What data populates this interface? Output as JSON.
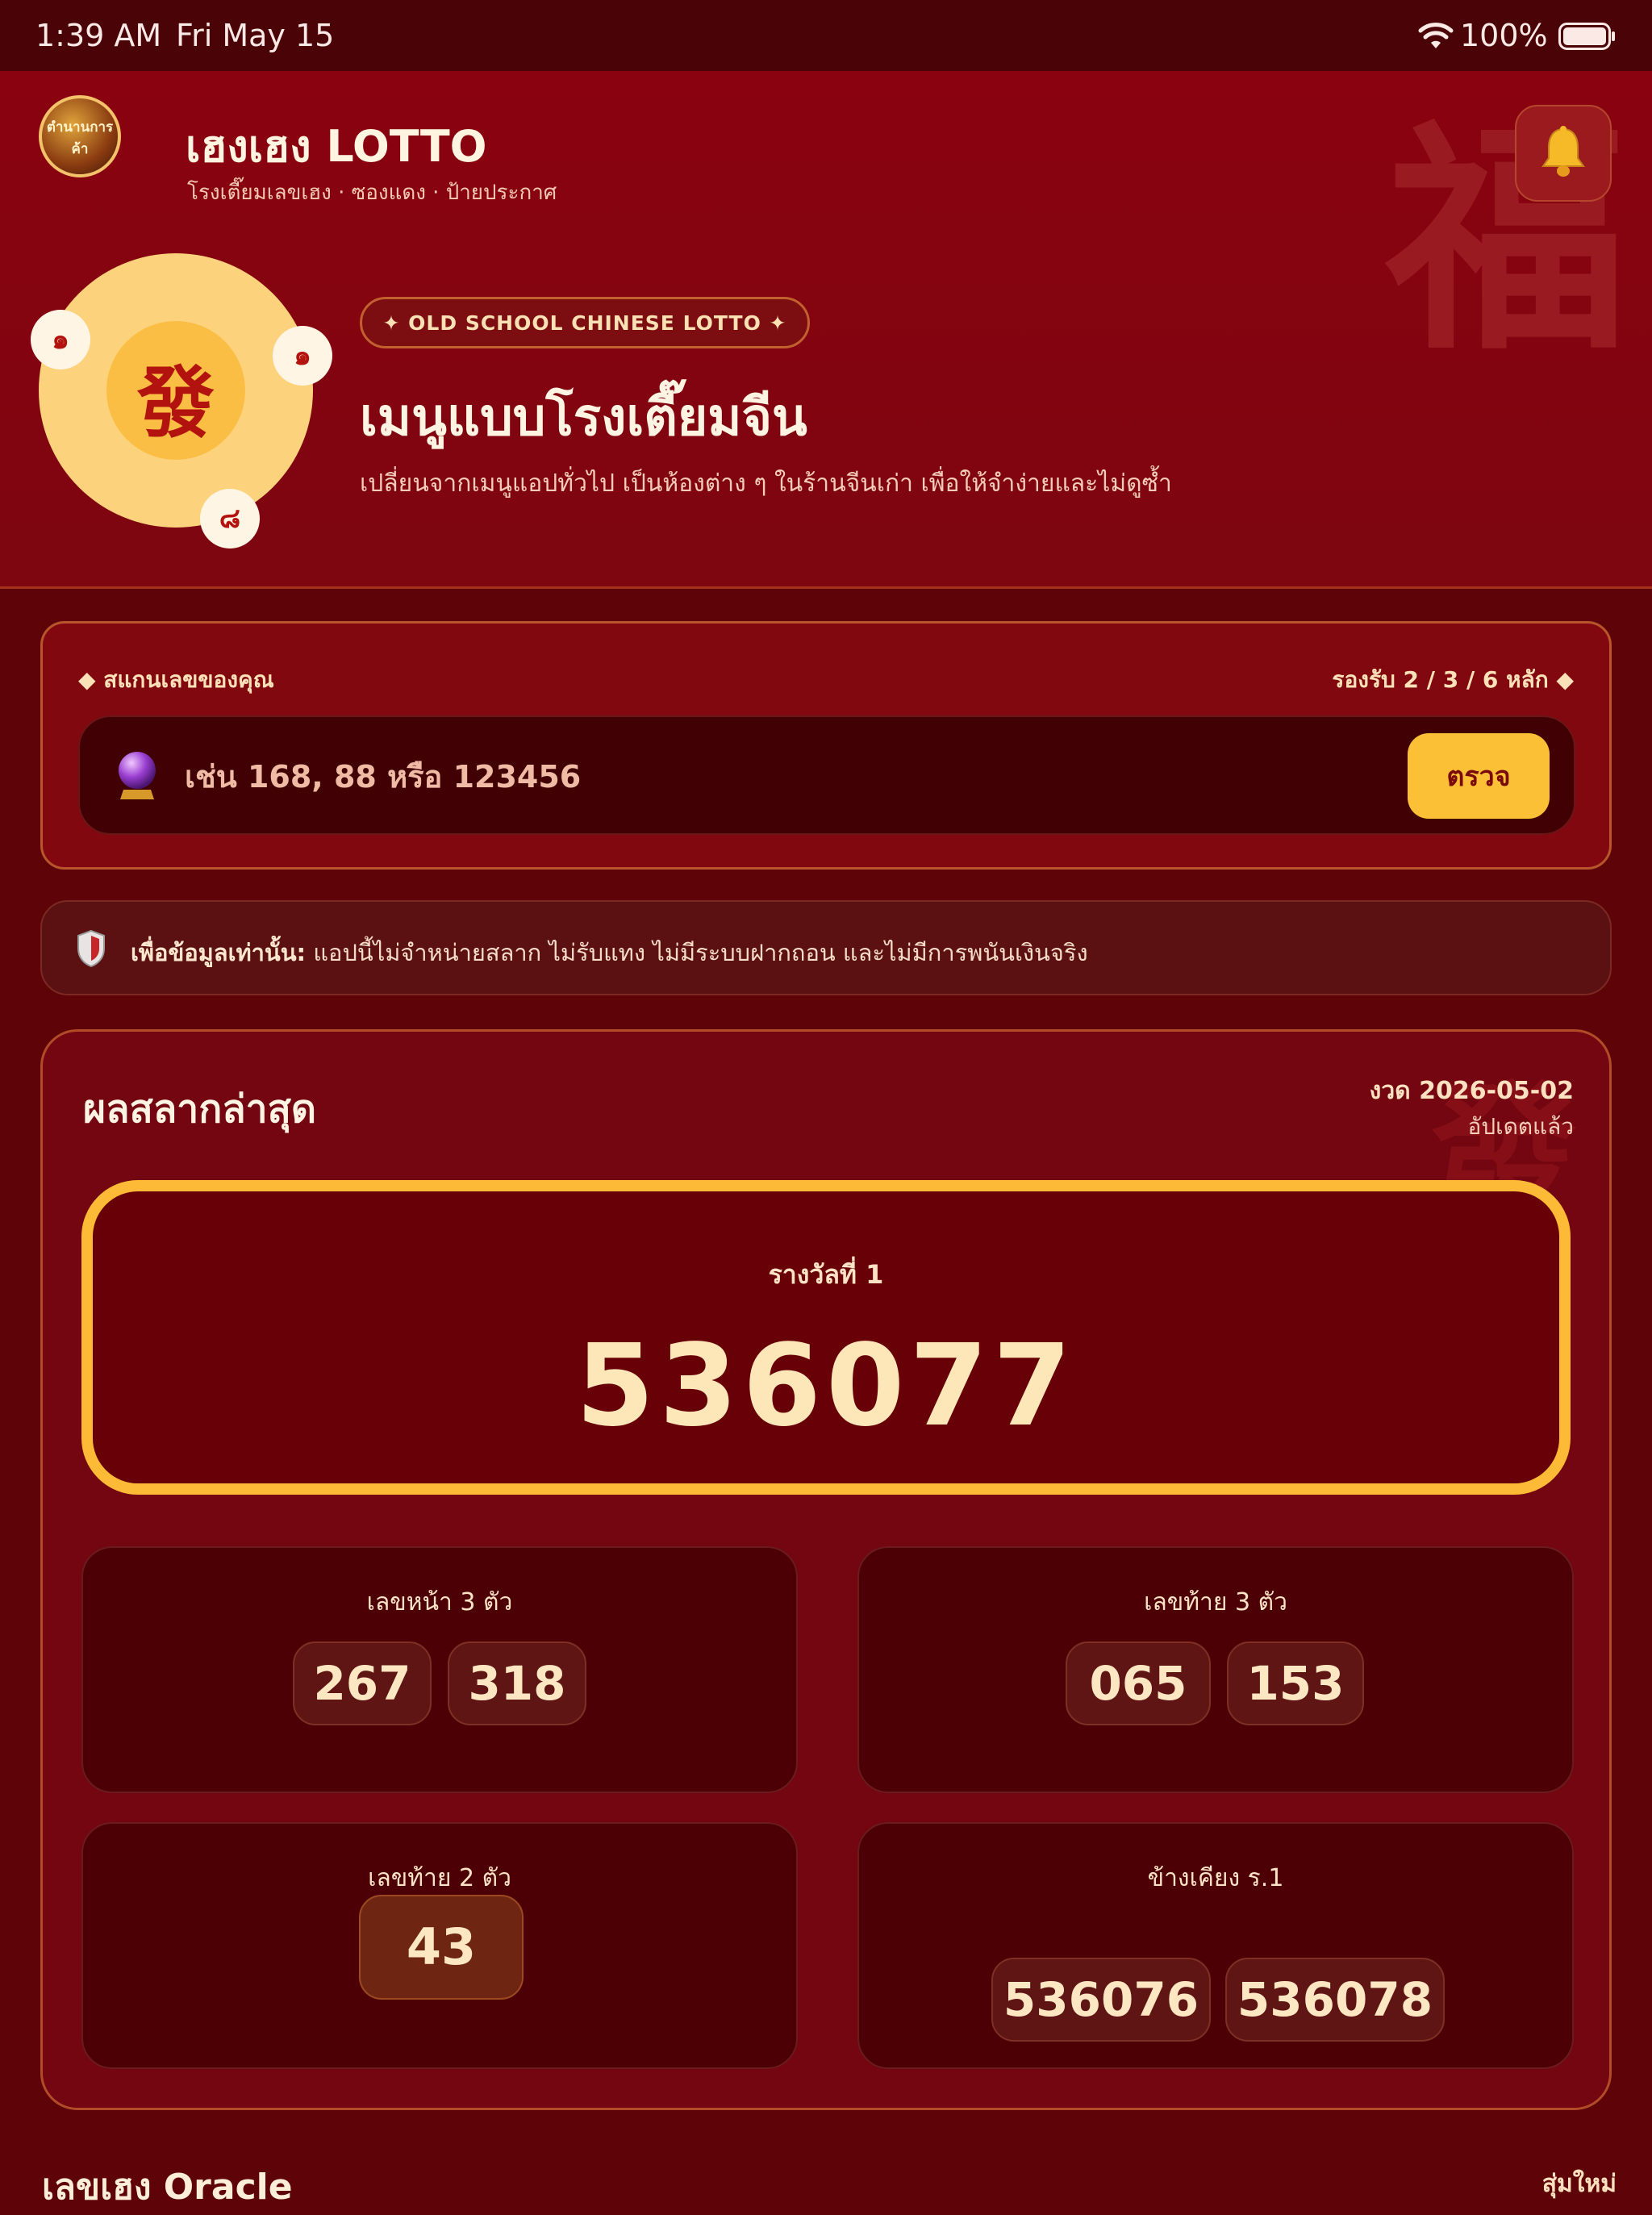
{
  "status_bar": {
    "time": "1:39 AM",
    "date": "Fri May 15",
    "battery": "100%"
  },
  "header": {
    "avatar_text": "ตำนานการค้า",
    "title": "เฮงเฮง LOTTO",
    "subtitle": "โรงเตี๊ยมเลขเฮง · ซองแดง · ป้ายประกาศ",
    "bell_icon": "bell-icon",
    "bg_char": "福"
  },
  "hero": {
    "coin_char": "發",
    "coin_numbers": [
      "๑",
      "๑",
      "๘"
    ],
    "badge": "✦ OLD SCHOOL CHINESE LOTTO ✦",
    "title": "เมนูแบบโรงเตี๊ยมจีน",
    "subtitle": "เปลี่ยนจากเมนูแอปทั่วไป เป็นห้องต่าง ๆ ในร้านจีนเก่า เพื่อให้จำง่ายและไม่ดูซ้ำ"
  },
  "scan": {
    "label": "◆ สแกนเลขของคุณ",
    "support": "รองรับ 2 / 3 / 6 หลัก ◆",
    "placeholder": "เช่น 168, 88 หรือ 123456",
    "button": "ตรวจ"
  },
  "disclaimer": {
    "bold": "เพื่อข้อมูลเท่านั้น:",
    "text": " แอปนี้ไม่จำหน่ายสลาก ไม่รับแทง ไม่มีระบบฝากถอน และไม่มีการพนันเงินจริง"
  },
  "results": {
    "title": "ผลสลากล่าสุด",
    "draw_date": "งวด 2026-05-02",
    "draw_status": "อัปเดตแล้ว",
    "bg_char": "發",
    "first_prize": {
      "label": "รางวัลที่ 1",
      "number": "536077"
    },
    "front3": {
      "label": "เลขหน้า 3 ตัว",
      "numbers": [
        "267",
        "318"
      ]
    },
    "back3": {
      "label": "เลขท้าย 3 ตัว",
      "numbers": [
        "065",
        "153"
      ]
    },
    "back2": {
      "label": "เลขท้าย 2 ตัว",
      "numbers": [
        "43"
      ]
    },
    "near": {
      "label": "ข้างเคียง ร.1",
      "numbers": [
        "536076",
        "536078"
      ]
    }
  },
  "oracle": {
    "title": "เลขเฮง Oracle",
    "shuffle": "สุ่มใหม่"
  },
  "colors": {
    "primary_red": "#8a020f",
    "gold": "#fdba36",
    "button_gold": "#fcc037",
    "cream": "#fde7b8"
  }
}
